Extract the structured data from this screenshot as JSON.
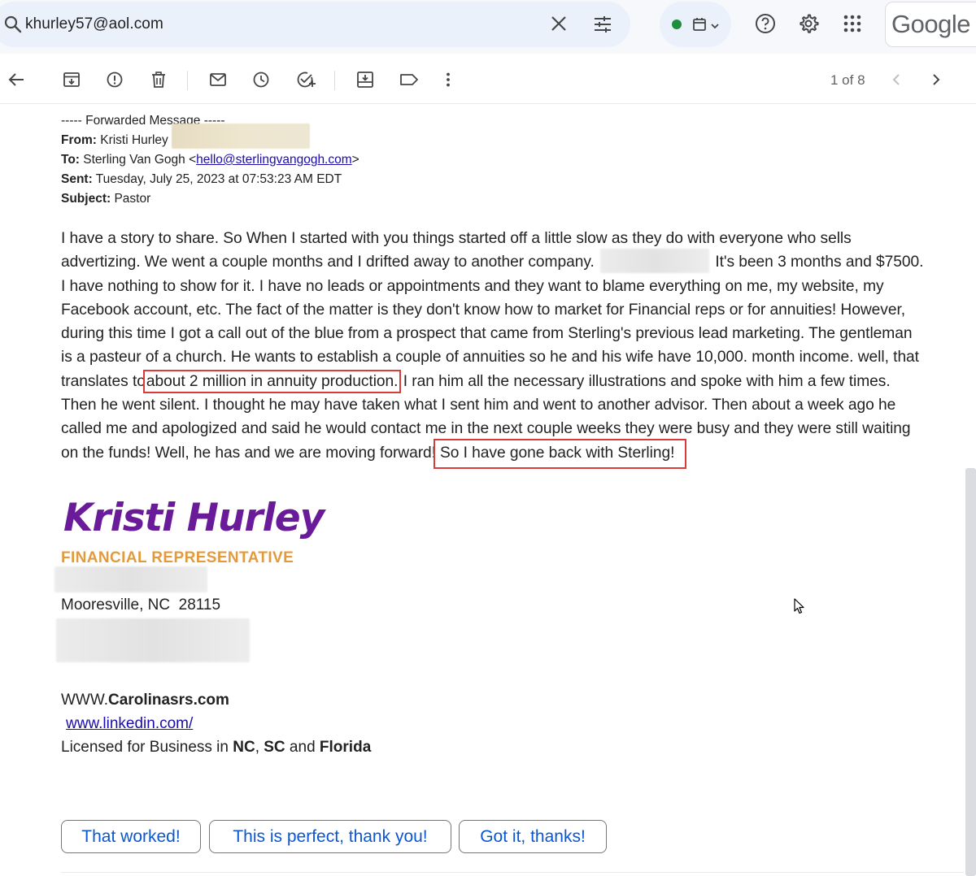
{
  "search": {
    "query": "khurley57@aol.com"
  },
  "header": {
    "brand": "Google"
  },
  "toolbar": {
    "pager": "1 of 8"
  },
  "email": {
    "forwarded_header": "----- Forwarded Message -----",
    "from_label": "From:",
    "from_name": "Kristi Hurley",
    "to_label": "To:",
    "to_name": "Sterling Van Gogh",
    "to_email": "hello@sterlingvangogh.com",
    "sent_label": "Sent:",
    "sent_value": "Tuesday, July 25, 2023 at 07:53:23 AM EDT",
    "subject_label": "Subject:",
    "subject_value": "Pastor",
    "body": {
      "l1": "I have a story to share. So When I started with you things started off a little slow as they do with everyone who sells",
      "l2a": "advertizing. We went a couple months and I drifted away to another company.",
      "l2b": "It's been 3 months and $7500.",
      "l3": "I have nothing to show for it. I have no leads or appointments and they want to blame everything on me, my website, my",
      "l4": "Facebook account, etc. The fact of the matter is they don't know how to market for Financial reps or for annuities! However,",
      "l5": "during this time I got a call out of the blue from a prospect that came from Sterling's previous lead marketing. The gentleman",
      "l6": "is a pasteur of a church. He wants to establish a couple of annuities so he and his wife have 10,000. month income. well, that",
      "l7a": "translates to",
      "l7b": "about 2 million in annuity production.",
      "l7c": "I ran him all the necessary illustrations and spoke with him a few times.",
      "l8": "Then he went silent. I thought he may have taken what I sent him and went to another advisor. Then about a week ago he",
      "l9": "called me and apologized and said he would contact me in the next couple weeks they were busy and they were still waiting",
      "l10a": "on the funds! Well, he has and we are moving forward!",
      "l10b": "So I have gone back with Sterling!"
    },
    "signature": {
      "name": "Kristi Hurley",
      "title": "FINANCIAL REPRESENTATIVE",
      "city": "Mooresville, NC  28115",
      "www_prefix": "WWW.",
      "www_domain": "Carolinasrs.com",
      "linkedin": "www.linkedin.com/",
      "lic_prefix": "Licensed for Business in ",
      "lic_nc": "NC",
      "lic_comma": ", ",
      "lic_sc": "SC",
      "lic_and": " and ",
      "lic_fl": "Florida"
    }
  },
  "smart_replies": [
    "That worked!",
    "This is perfect, thank you!",
    "Got it, thanks!"
  ],
  "colors": {
    "accent": "#0b57d0",
    "signature_name": "#6a1b9a",
    "signature_title": "#e39a3c",
    "highlight_box": "#d93a3a",
    "status_active": "#1e8e3e"
  }
}
